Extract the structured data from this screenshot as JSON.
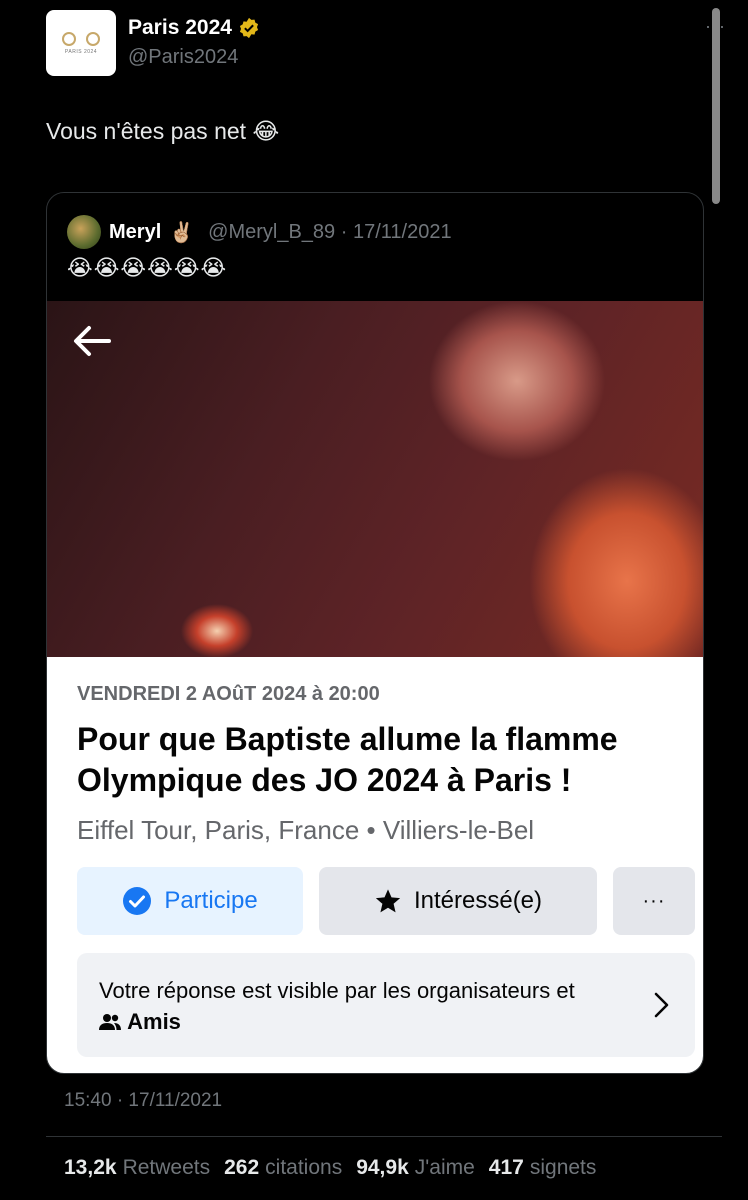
{
  "author": {
    "display_name": "Paris 2024",
    "handle": "@Paris2024",
    "more": "···"
  },
  "tweet": {
    "text": "Vous n'êtes pas net 😂",
    "timestamp": "15:40 · 17/11/2021"
  },
  "quoted": {
    "name": "Meryl",
    "name_emoji": "✌🏼",
    "handle_date": "@Meryl_B_89 · 17/11/2021",
    "emojis": "😭😭😭😭😭😭"
  },
  "event_card": {
    "date": "VENDREDI 2 AOûT 2024 à 20:00",
    "title": "Pour que Baptiste allume la flamme Olympique des JO 2024 à Paris !",
    "location": "Eiffel Tour, Paris, France • Villiers-le-Bel",
    "participe_label": "Participe",
    "interesse_label": "Intéressé(e)",
    "more_label": "···",
    "visibility_text": "Votre réponse est visible par les organisateurs et",
    "visibility_amis": "Amis"
  },
  "stats": [
    {
      "value": "13,2k",
      "label": "Retweets"
    },
    {
      "value": "262",
      "label": "citations"
    },
    {
      "value": "94,9k",
      "label": "J'aime"
    },
    {
      "value": "417",
      "label": "signets"
    }
  ],
  "colors": {
    "background": "#000000",
    "verified": "#e2b719",
    "facebook_blue": "#1877f2"
  }
}
